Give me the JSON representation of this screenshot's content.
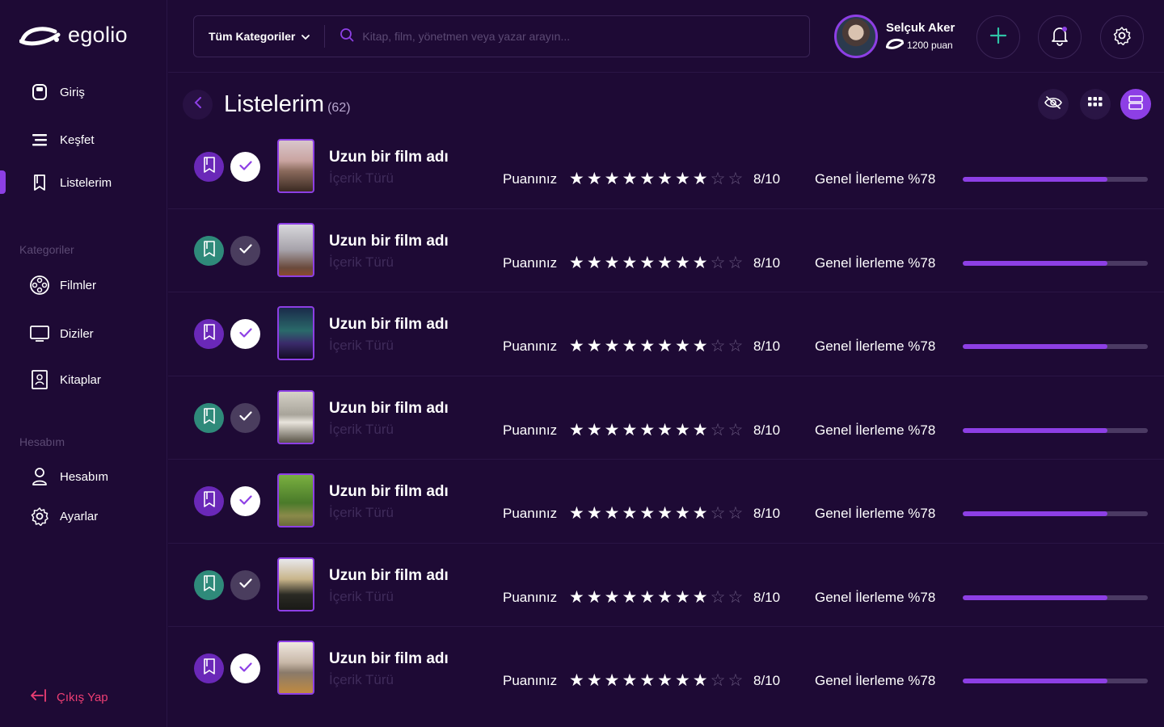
{
  "app": {
    "logo_text": "egolio"
  },
  "sidebar": {
    "main_items": [
      {
        "label": "Giriş",
        "icon": "home-icon"
      },
      {
        "label": "Keşfet",
        "icon": "explore-icon"
      },
      {
        "label": "Listelerim",
        "icon": "bookmark-icon",
        "active": true
      }
    ],
    "categories_title": "Kategoriler",
    "categories": [
      {
        "label": "Filmler",
        "icon": "film-reel-icon"
      },
      {
        "label": "Diziler",
        "icon": "tv-icon"
      },
      {
        "label": "Kitaplar",
        "icon": "book-icon"
      }
    ],
    "account_title": "Hesabım",
    "account_items": [
      {
        "label": "Hesabım",
        "icon": "user-icon"
      },
      {
        "label": "Ayarlar",
        "icon": "gear-icon"
      }
    ],
    "logout_label": "Çıkış Yap"
  },
  "header": {
    "category_select": "Tüm Kategoriler",
    "search_placeholder": "Kitap, film, yönetmen veya yazar arayın...",
    "user_name": "Selçuk Aker",
    "user_points": "1200 puan"
  },
  "page": {
    "title": "Listelerim",
    "count": "(62)"
  },
  "colors": {
    "accent": "#8d3fe5",
    "teal": "#2f8a7a",
    "background": "#1e0a35",
    "danger": "#ee3e74"
  },
  "list_items": [
    {
      "title": "Uzun bir film adı",
      "subtitle": "İçerik Türü",
      "rating_label": "Puanınız",
      "rating": 8,
      "max_rating": 10,
      "score_text": "8/10",
      "progress_label": "Genel İlerleme %78",
      "progress": 0.78,
      "bookmark_color": "purple",
      "checked": true,
      "poster": "sunset"
    },
    {
      "title": "Uzun bir film adı",
      "subtitle": "İçerik Türü",
      "rating_label": "Puanınız",
      "rating": 8,
      "max_rating": 10,
      "score_text": "8/10",
      "progress_label": "Genel İlerleme %78",
      "progress": 0.78,
      "bookmark_color": "teal",
      "checked": false,
      "poster": "forest"
    },
    {
      "title": "Uzun bir film adı",
      "subtitle": "İçerik Türü",
      "rating_label": "Puanınız",
      "rating": 8,
      "max_rating": 10,
      "score_text": "8/10",
      "progress_label": "Genel İlerleme %78",
      "progress": 0.78,
      "bookmark_color": "purple",
      "checked": true,
      "poster": "aurora"
    },
    {
      "title": "Uzun bir film adı",
      "subtitle": "İçerik Türü",
      "rating_label": "Puanınız",
      "rating": 8,
      "max_rating": 10,
      "score_text": "8/10",
      "progress_label": "Genel İlerleme %78",
      "progress": 0.78,
      "bookmark_color": "teal",
      "checked": false,
      "poster": "plane"
    },
    {
      "title": "Uzun bir film adı",
      "subtitle": "İçerik Türü",
      "rating_label": "Puanınız",
      "rating": 8,
      "max_rating": 10,
      "score_text": "8/10",
      "progress_label": "Genel İlerleme %78",
      "progress": 0.78,
      "bookmark_color": "purple",
      "checked": true,
      "poster": "tree"
    },
    {
      "title": "Uzun bir film adı",
      "subtitle": "İçerik Türü",
      "rating_label": "Puanınız",
      "rating": 8,
      "max_rating": 10,
      "score_text": "8/10",
      "progress_label": "Genel İlerleme %78",
      "progress": 0.78,
      "bookmark_color": "teal",
      "checked": false,
      "poster": "mountain"
    },
    {
      "title": "Uzun bir film adı",
      "subtitle": "İçerik Türü",
      "rating_label": "Puanınız",
      "rating": 8,
      "max_rating": 10,
      "score_text": "8/10",
      "progress_label": "Genel İlerleme %78",
      "progress": 0.78,
      "bookmark_color": "purple",
      "checked": true,
      "poster": "field"
    }
  ]
}
